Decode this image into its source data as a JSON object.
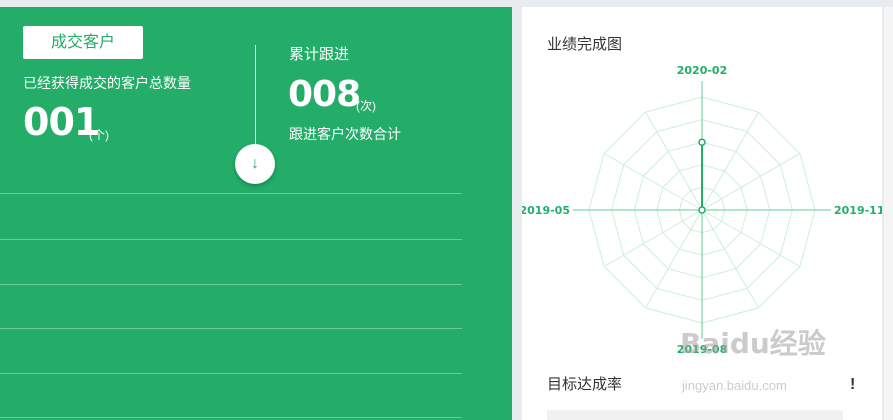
{
  "deal_panel": {
    "tag_label": "成交客户",
    "deal_description": "已经获得成交的客户总数量",
    "deal_count": "001",
    "deal_unit": "(个)",
    "followup_title": "累计跟进",
    "followup_count": "008",
    "followup_unit": "(次)",
    "followup_description": "跟进客户次数合计",
    "toggle_icon": "arrow-down-icon",
    "toggle_glyph": "↓"
  },
  "performance_panel": {
    "title": "业绩完成图",
    "target_title": "目标达成率",
    "alert_glyph": "!",
    "chart_data": {
      "type": "radar",
      "axes": [
        "2020-02",
        "2019-11",
        "2019-08",
        "2019-05"
      ],
      "values": [
        0.6,
        0,
        0,
        0
      ],
      "ring_count": 5,
      "polygon_sides": 12,
      "color": "#23ad68"
    }
  },
  "watermark": {
    "main": "Baidu经验",
    "sub": "jingyan.baidu.com"
  },
  "colors": {
    "accent": "#23ad68",
    "panel_bg": "#ffffff",
    "page_bg": "#e9ecef"
  }
}
